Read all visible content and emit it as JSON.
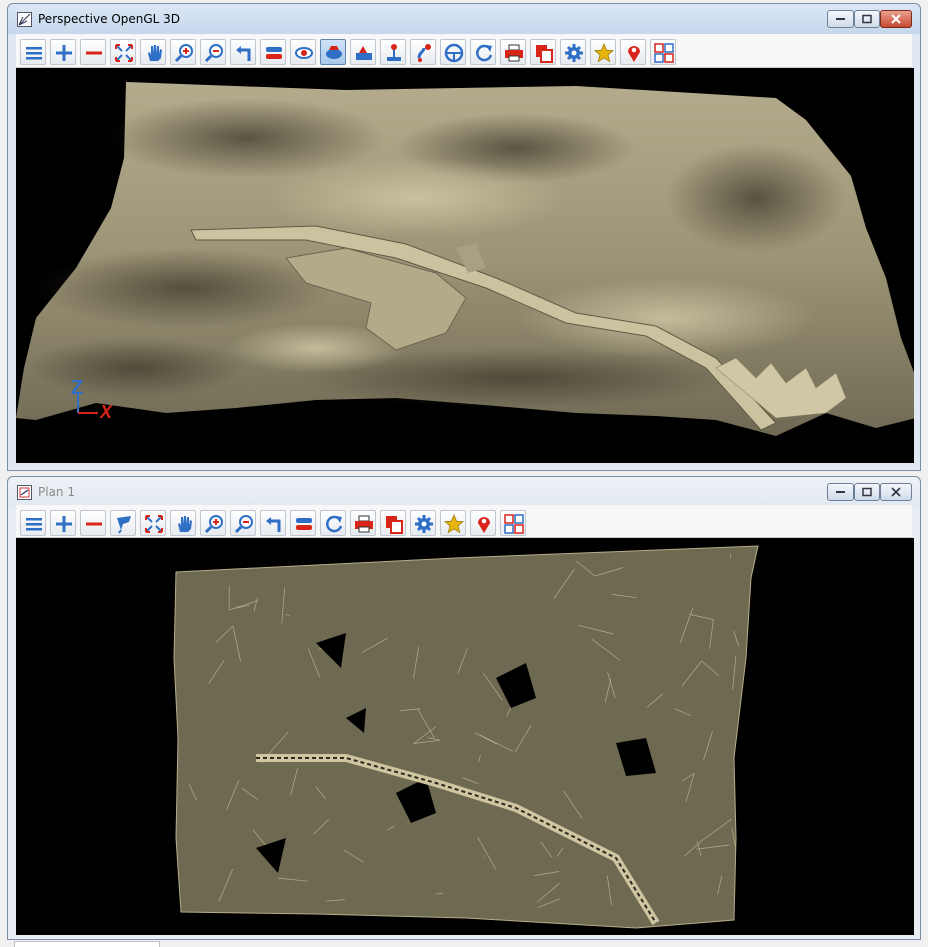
{
  "windows": {
    "perspective": {
      "title": "Perspective OpenGL 3D",
      "icon": "perspective-view-icon"
    },
    "plan": {
      "title": "Plan 1",
      "icon": "plan-view-icon"
    }
  },
  "perspective_toolbar": [
    "menu-icon",
    "zoom-in-plus-icon",
    "zoom-out-minus-icon",
    "zoom-extent-icon",
    "pan-hand-icon",
    "zoom-window-icon",
    "zoom-icon",
    "undo-view-icon",
    "toggle-icon",
    "view-eye-icon",
    "shade-icon",
    "render-icon",
    "joystick-icon",
    "walk-icon",
    "steering-wheel-icon",
    "redraw-icon",
    "print-icon",
    "copy-icon",
    "settings-gear-icon",
    "favorite-star-icon",
    "location-pin-icon",
    "tiles-icon"
  ],
  "plan_toolbar": [
    "menu-icon",
    "zoom-in-plus-icon",
    "zoom-out-minus-icon",
    "brush-icon",
    "zoom-extent-icon",
    "pan-hand-icon",
    "zoom-window-icon",
    "zoom-icon",
    "undo-view-icon",
    "toggle-icon",
    "redraw-icon",
    "print-icon",
    "copy-icon",
    "settings-gear-icon",
    "favorite-star-icon",
    "location-pin-icon",
    "tiles-icon"
  ],
  "axis": {
    "z": "Z",
    "x": "X"
  },
  "colors": {
    "terrain": "#8a8467",
    "mesh": "#b8ad88",
    "viewport_bg": "#000000",
    "accent_blue": "#2f6fc6",
    "accent_red": "#d9241a"
  }
}
